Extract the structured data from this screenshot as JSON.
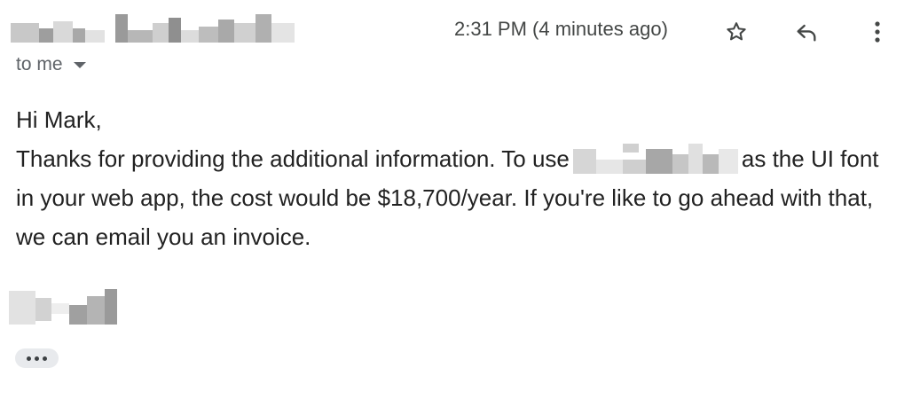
{
  "header": {
    "sender_name_redacted": "sender-name-redacted",
    "timestamp": "2:31 PM (4 minutes ago)",
    "star_icon": "star-outline-icon",
    "reply_icon": "reply-arrow-icon",
    "more_icon": "vertical-dots-icon",
    "recipient_label": "to me",
    "recipient_caret_icon": "caret-down-icon"
  },
  "message": {
    "greeting": "Hi Mark,",
    "line1_before": "Thanks for providing the additional information. To use",
    "line1_redacted": "font-name-redacted",
    "line1_after": "as the UI font in your web app, the cost would be $18,700/year. If you're like to go ahead with that, we can email you an invoice.",
    "signature_redacted": "signature-redacted"
  },
  "footer": {
    "show_trimmed_icon": "ellipsis-icon"
  },
  "colors": {
    "text": "#222222",
    "secondary_text": "#5f6368",
    "icon": "#444746",
    "pill_bg": "#e8eaed"
  }
}
